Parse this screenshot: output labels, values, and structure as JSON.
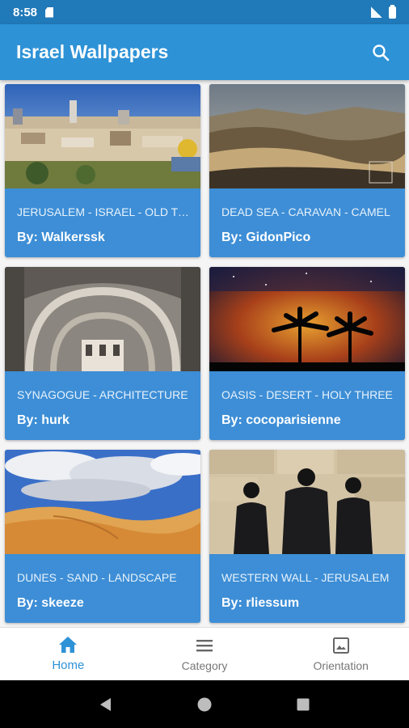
{
  "status_bar": {
    "time": "8:58"
  },
  "app_bar": {
    "title": "Israel Wallpapers"
  },
  "cards": [
    {
      "title": "JERUSALEM - ISRAEL - OLD TOWN",
      "author": "By: Walkerssk"
    },
    {
      "title": "DEAD SEA - CARAVAN - CAMEL",
      "author": "By: GidonPico"
    },
    {
      "title": "SYNAGOGUE - ARCHITECTURE",
      "author": "By: hurk"
    },
    {
      "title": "OASIS - DESERT - HOLY THREE",
      "author": "By: cocoparisienne"
    },
    {
      "title": "DUNES - SAND - LANDSCAPE",
      "author": "By: skeeze"
    },
    {
      "title": "WESTERN WALL - JERUSALEM",
      "author": "By: rliessum"
    }
  ],
  "bottom_nav": [
    {
      "label": "Home",
      "icon": "home-icon",
      "active": true
    },
    {
      "label": "Category",
      "icon": "menu-icon",
      "active": false
    },
    {
      "label": "Orientation",
      "icon": "image-icon",
      "active": false
    }
  ],
  "colors": {
    "primary": "#2e92d6",
    "status_bar": "#2079b8",
    "card": "#3d8ed6"
  }
}
